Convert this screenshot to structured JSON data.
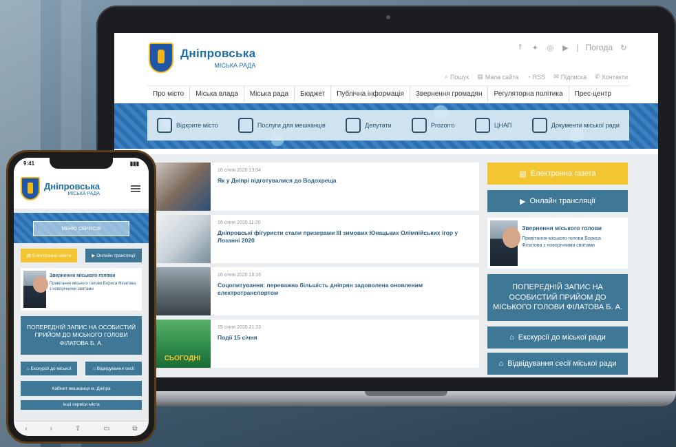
{
  "site": {
    "logo_main": "Дніпровська",
    "logo_sub": "МІСЬКА РАДА",
    "weather_label": "Погода"
  },
  "social_icons": [
    "facebook-icon",
    "twitter-icon",
    "instagram-icon",
    "youtube-icon"
  ],
  "utility_links": [
    {
      "icon": "search-icon",
      "label": "Пошук"
    },
    {
      "icon": "sitemap-icon",
      "label": "Мапа сайта"
    },
    {
      "icon": "rss-icon",
      "label": "RSS"
    },
    {
      "icon": "mail-icon",
      "label": "Підписка"
    },
    {
      "icon": "phone-icon",
      "label": "Контакти"
    }
  ],
  "nav": [
    "Про місто",
    "Міська влада",
    "Міська рада",
    "Бюджет",
    "Публічна інформація",
    "Звернення громадян",
    "Регуляторна політика",
    "Прес-центр"
  ],
  "services": [
    {
      "icon": "monitor-icon",
      "label": "Відкрите місто"
    },
    {
      "icon": "building-icon",
      "label": "Послуги для мешканців"
    },
    {
      "icon": "person-icon",
      "label": "Депутати"
    },
    {
      "icon": "calendar-icon",
      "label": "Prozorro"
    },
    {
      "icon": "lightbulb-icon",
      "label": "ЦНАП"
    },
    {
      "icon": "document-icon",
      "label": "Документи міської ради"
    }
  ],
  "news": [
    {
      "date": "16 січня 2020 13:04",
      "title": "Як у Дніпрі підготувалися до Водохреща"
    },
    {
      "date": "16 січня 2020 11:20",
      "title": "Дніпровські фігуристи стали призерами ІІІ зимових Юнацьких Олімпійських ігор у Лозанні 2020"
    },
    {
      "date": "16 січня 2020 10:16",
      "title": "Соцопитування: переважна більшість дніпрян задоволена оновленим електротранспортом"
    },
    {
      "date": "15 січня 2020 21:23",
      "title": "Події 15 січня"
    }
  ],
  "news_thumb_text": "СЬОГОДНІ",
  "sidebar": {
    "newspaper": "Електронна газета",
    "broadcasts": "Онлайн трансляції",
    "mayor_title": "Звернення міського голови",
    "mayor_desc": "Привітання міського голови Бориса Філатова з новорічними святами",
    "record": "ПОПЕРЕДНІЙ ЗАПИС НА ОСОБИСТИЙ ПРИЙОМ ДО МІСЬКОГО ГОЛОВИ ФІЛАТОВА Б. А.",
    "excursions": "Екскурсії до міської ради",
    "sessions": "Відвідування сесії міської ради"
  },
  "phone": {
    "time": "9:41",
    "menu_services": "МЕНЮ СЕРВІСІВ",
    "newspaper": "Електронна газета",
    "broadcasts": "Онлайн трансляції",
    "mayor_title": "Звернення міського голови",
    "mayor_desc": "Привітання міського голови Бориса Філатова з новорічними святами",
    "record": "ПОПЕРЕДНІЙ ЗАПИС НА ОСОБИСТИЙ ПРИЙОМ ДО МІСЬКОГО ГОЛОВИ ФІЛАТОВА Б. А.",
    "excursions": "Екскурсії до міської",
    "sessions": "Відвідування сесії",
    "cabinet": "Кабінет мешканця м. Дніпра",
    "other": "Інші сервіси міста"
  },
  "colors": {
    "accent": "#3f7896",
    "yellow": "#f2c531",
    "link": "#2a5f86",
    "brand": "#1b6da3"
  }
}
